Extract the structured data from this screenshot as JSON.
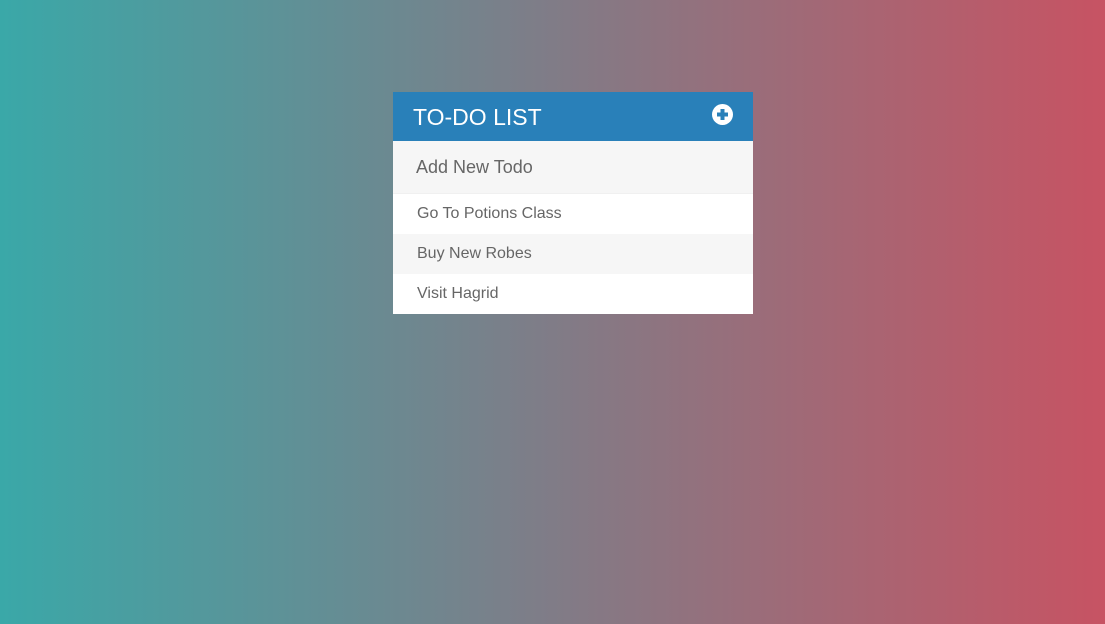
{
  "header": {
    "title": "TO-DO LIST",
    "add_icon": "plus-circle-icon"
  },
  "new_todo": {
    "placeholder": "Add New Todo"
  },
  "todos": [
    {
      "label": "Go To Potions Class"
    },
    {
      "label": "Buy New Robes"
    },
    {
      "label": "Visit Hagrid"
    }
  ],
  "colors": {
    "header_bg": "#2980b9",
    "gradient_left": "#3aa8a8",
    "gradient_right": "#c75363"
  }
}
